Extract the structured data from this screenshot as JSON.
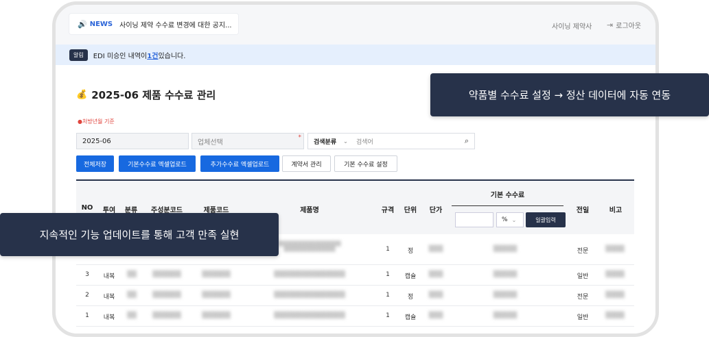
{
  "news": {
    "label": "NEWS",
    "text": "사이닝 제약 수수료 변경에 대한 공지..."
  },
  "header": {
    "company": "사이닝 제약사",
    "logout": "로그아웃"
  },
  "alert": {
    "badge": "알림",
    "text_pre": "EDI 미승인 내역이 ",
    "link": "1건",
    "text_post": " 있습니다."
  },
  "page": {
    "title": "2025-06 제품 수수료 관리",
    "note": "●처방년월 기준"
  },
  "filters": {
    "month": "2025-06",
    "vendor_placeholder": "업체선택",
    "search_type": "검색분류",
    "search_placeholder": "검색어"
  },
  "buttons": {
    "save_all": "전체저장",
    "base_upload": "기본수수료 엑셀업로드",
    "extra_upload": "추가수수료 엑셀업로드",
    "contract": "계약서 관리",
    "base_setting": "기본 수수료 설정"
  },
  "table": {
    "headers": {
      "no": "NO",
      "route": "투여",
      "type": "분류",
      "ingredient": "주성분코드",
      "product_code": "제품코드",
      "product_name": "제품명",
      "spec": "규격",
      "unit": "단위",
      "price": "단가",
      "base_fee": "기본 수수료",
      "specialty": "전일",
      "note": "비고"
    },
    "pct_option": "%",
    "bulk_button": "일괄입력",
    "rows": [
      {
        "no": "",
        "route": "",
        "spec": "1",
        "unit": "정",
        "specialty": "전문"
      },
      {
        "no": "3",
        "route": "내복",
        "spec": "1",
        "unit": "캡슐",
        "specialty": "일반"
      },
      {
        "no": "2",
        "route": "내복",
        "spec": "1",
        "unit": "정",
        "specialty": "전문"
      },
      {
        "no": "1",
        "route": "내복",
        "spec": "1",
        "unit": "캡슐",
        "specialty": "일반"
      }
    ]
  },
  "callouts": {
    "right": "약품별 수수료 설정 → 정산 데이터에 자동 연동",
    "left": "지속적인 기능 업데이트를 통해 고객 만족 실현"
  }
}
